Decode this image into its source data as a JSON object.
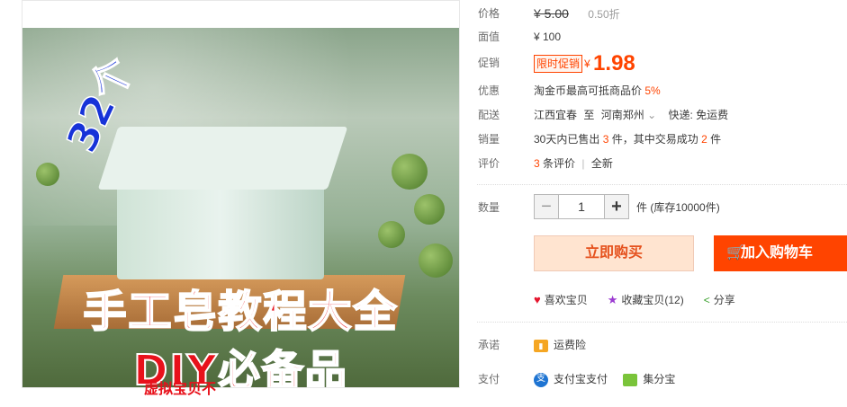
{
  "image": {
    "count_text": "32个",
    "title_line1": "手工皂教程大全",
    "title_line2": "DIY必备品"
  },
  "price": {
    "label": "价格",
    "original": "¥ 5.00",
    "discount": "0.50折"
  },
  "face_value": {
    "label": "面值",
    "value": "¥ 100"
  },
  "promo": {
    "label": "促销",
    "tag": "限时促销",
    "yen": "¥",
    "amount": "1.98"
  },
  "benefit": {
    "label": "优惠",
    "text": "淘金币最高可抵商品价",
    "percent": "5%"
  },
  "delivery": {
    "label": "配送",
    "from": "江西宜春",
    "to_word": "至",
    "to": "河南郑州",
    "chevron": "⌄",
    "express": "快递: 免运费"
  },
  "sales": {
    "label": "销量",
    "pre": "30天内已售出",
    "sold": "3",
    "mid": "件，其中交易成功",
    "success": "2",
    "post": "件"
  },
  "reviews": {
    "label": "评价",
    "count": "3",
    "count_text": "条评价",
    "sep": "|",
    "status": "全新"
  },
  "quantity": {
    "label": "数量",
    "minus": "−",
    "value": "1",
    "plus": "+",
    "unit": "件 (库存10000件)"
  },
  "buttons": {
    "buy": "立即购买",
    "cart": "加入购物车",
    "cart_icon": "🛒"
  },
  "actions": [
    {
      "icon": "heart-icon",
      "glyph": "♥",
      "label": "喜欢宝贝"
    },
    {
      "icon": "star-icon",
      "glyph": "★",
      "label": "收藏宝贝(12)"
    },
    {
      "icon": "share-icon",
      "glyph": "<",
      "label": "分享"
    }
  ],
  "promise": {
    "label": "承诺",
    "text": "运费险"
  },
  "payment": {
    "label": "支付",
    "alipay": "支付宝支付",
    "other": "集分宝"
  },
  "overlay_text": "虚拟宝贝不",
  "colors": {
    "accent": "#ff4400",
    "price_red": "#f40",
    "buy_bg": "#ffe4d0"
  }
}
